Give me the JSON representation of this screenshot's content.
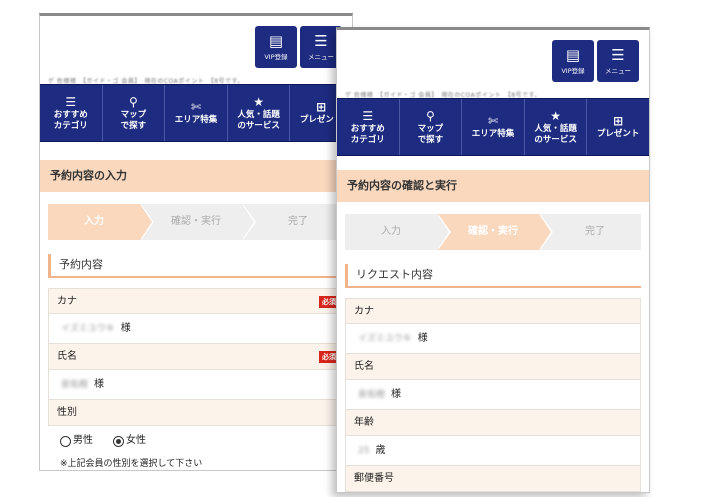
{
  "screen1": {
    "top": {
      "vip_label": "VIP登録",
      "menu_label": "メニュー",
      "blurred_line": "ゲ 佐様様　【ガイド・ゴ 会員】　現在のCOAポイント　【8号です。"
    },
    "nav": [
      {
        "icon": "list-icon",
        "glyph": "☰",
        "label1": "おすすめ",
        "label2": "カテゴリ"
      },
      {
        "icon": "map-pin-icon",
        "glyph": "⚲",
        "label1": "マップ",
        "label2": "で探す"
      },
      {
        "icon": "ticket-icon",
        "glyph": "✄",
        "label1": "エリア特集",
        "label2": ""
      },
      {
        "icon": "star-icon",
        "glyph": "★",
        "label1": "人気・話題",
        "label2": "のサービス"
      },
      {
        "icon": "gift-icon",
        "glyph": "⊞",
        "label1": "プレゼント",
        "label2": ""
      }
    ],
    "section_title": "予約内容の入力",
    "steps": [
      "入力",
      "確認・実行",
      "完了"
    ],
    "active_step": 0,
    "sub_title": "予約内容",
    "fields": {
      "kana_label": "カナ",
      "kana_value_blurred": "イズミユウキ",
      "kana_suffix": "様",
      "name_label": "氏名",
      "name_value_blurred": "泉佑樹",
      "name_suffix": "様",
      "required_badge": "必須",
      "gender_label": "性別",
      "gender_male": "男性",
      "gender_female": "女性",
      "gender_selected": "female",
      "note": "※上記会員の性別を選択して下さい"
    }
  },
  "screen2": {
    "top": {
      "vip_label": "VIP登録",
      "menu_label": "メニュー",
      "blurred_line": "ゲ 佐様様　【ガイド・ゴ 会員】　現在のCOAポイント　【8号です。"
    },
    "nav": [
      {
        "icon": "list-icon",
        "glyph": "☰",
        "label1": "おすすめ",
        "label2": "カテゴリ"
      },
      {
        "icon": "map-pin-icon",
        "glyph": "⚲",
        "label1": "マップ",
        "label2": "で探す"
      },
      {
        "icon": "ticket-icon",
        "glyph": "✄",
        "label1": "エリア特集",
        "label2": ""
      },
      {
        "icon": "star-icon",
        "glyph": "★",
        "label1": "人気・話題",
        "label2": "のサービス"
      },
      {
        "icon": "gift-icon",
        "glyph": "⊞",
        "label1": "プレゼント",
        "label2": ""
      }
    ],
    "section_title": "予約内容の確認と実行",
    "steps": [
      "入力",
      "確認・実行",
      "完了"
    ],
    "active_step": 1,
    "sub_title": "リクエスト内容",
    "fields": {
      "kana_label": "カナ",
      "kana_value_blurred": "イズミユウキ",
      "kana_suffix": "様",
      "name_label": "氏名",
      "name_value_blurred": "泉佑樹",
      "name_suffix": "様",
      "age_label": "年齢",
      "age_value_blurred": "25",
      "age_suffix": "歳",
      "postal_label": "郵便番号"
    }
  },
  "colors": {
    "nav_bg": "#1d2b80",
    "section_bg": "#f9d8be",
    "required_red": "#d9261c"
  }
}
